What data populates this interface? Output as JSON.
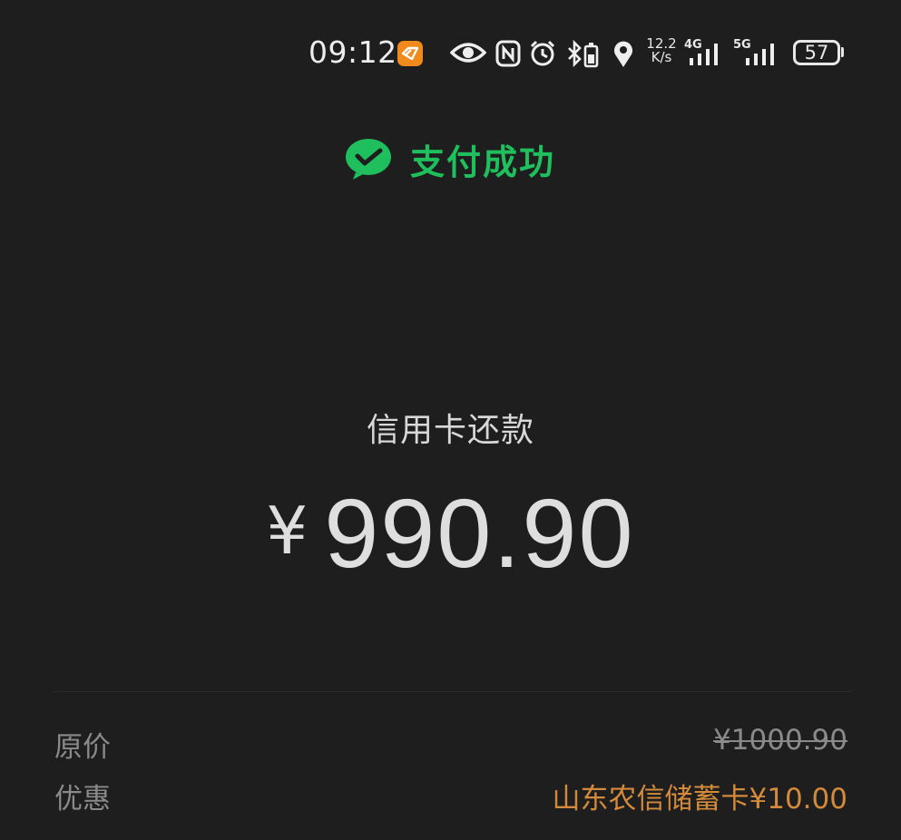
{
  "status_bar": {
    "time": "09:12",
    "net_speed_value": "12.2",
    "net_speed_unit": "K/s",
    "signal_1_label": "4G",
    "signal_2_label": "5G",
    "battery_level": "57",
    "icons": [
      "app-notification-icon",
      "eye-icon",
      "nfc-icon",
      "alarm-icon",
      "bluetooth-battery-icon",
      "location-icon",
      "signal-4g-icon",
      "signal-5g-icon",
      "battery-icon"
    ]
  },
  "header": {
    "success_text": "支付成功",
    "accent_color": "#1fbf5e"
  },
  "payment": {
    "title": "信用卡还款",
    "currency_symbol": "¥",
    "amount": "990.90"
  },
  "details": {
    "original_label": "原价",
    "original_value": "¥1000.90",
    "discount_label": "优惠",
    "discount_value": "山东农信储蓄卡¥10.00",
    "discount_color": "#d38a3a"
  }
}
